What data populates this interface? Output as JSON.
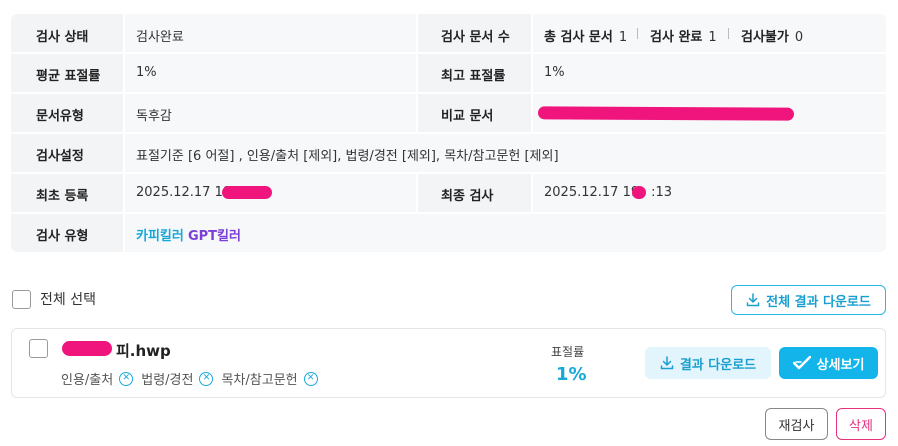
{
  "info": {
    "status_label": "검사 상태",
    "status_value": "검사완료",
    "doc_count_label": "검사 문서 수",
    "stats": {
      "total_label": "총 검사 문서",
      "total_value": "1",
      "done_label": "검사 완료",
      "done_value": "1",
      "fail_label": "검사불가",
      "fail_value": "0"
    },
    "avg_rate_label": "평균 표절률",
    "avg_rate_value": "1%",
    "max_rate_label": "최고 표절률",
    "max_rate_value": "1%",
    "doc_type_label": "문서유형",
    "doc_type_value": "독후감",
    "compare_label": "비교 문서",
    "settings_label": "검사설정",
    "settings_value": "표절기준 [6 어절] , 인용/출처 [제외], 법령/경전 [제외], 목차/참고문헌 [제외]",
    "first_reg_label": "최초 등록",
    "first_reg_value": "2025.12.17 19:",
    "last_check_label": "최종 검사",
    "last_check_value_a": "2025.12.17 19",
    "last_check_value_b": ":13",
    "check_type_label": "검사 유형",
    "check_type_a": "카피킬러",
    "check_type_b": "GPT킬러"
  },
  "list": {
    "select_all_label": "전체 선택",
    "download_all_label": "전체 결과 다운로드"
  },
  "file": {
    "name_suffix": "피.hwp",
    "tags": [
      "인용/출처",
      "법령/경전",
      "목차/참고문헌"
    ],
    "rate_label": "표절률",
    "rate_value": "1%",
    "download_label": "결과 다운로드",
    "detail_label": "상세보기"
  },
  "actions": {
    "recheck_label": "재검사",
    "delete_label": "삭제"
  },
  "colors": {
    "accent": "#12b4ea",
    "redaction": "#f0157c",
    "delete": "#e6317f"
  }
}
